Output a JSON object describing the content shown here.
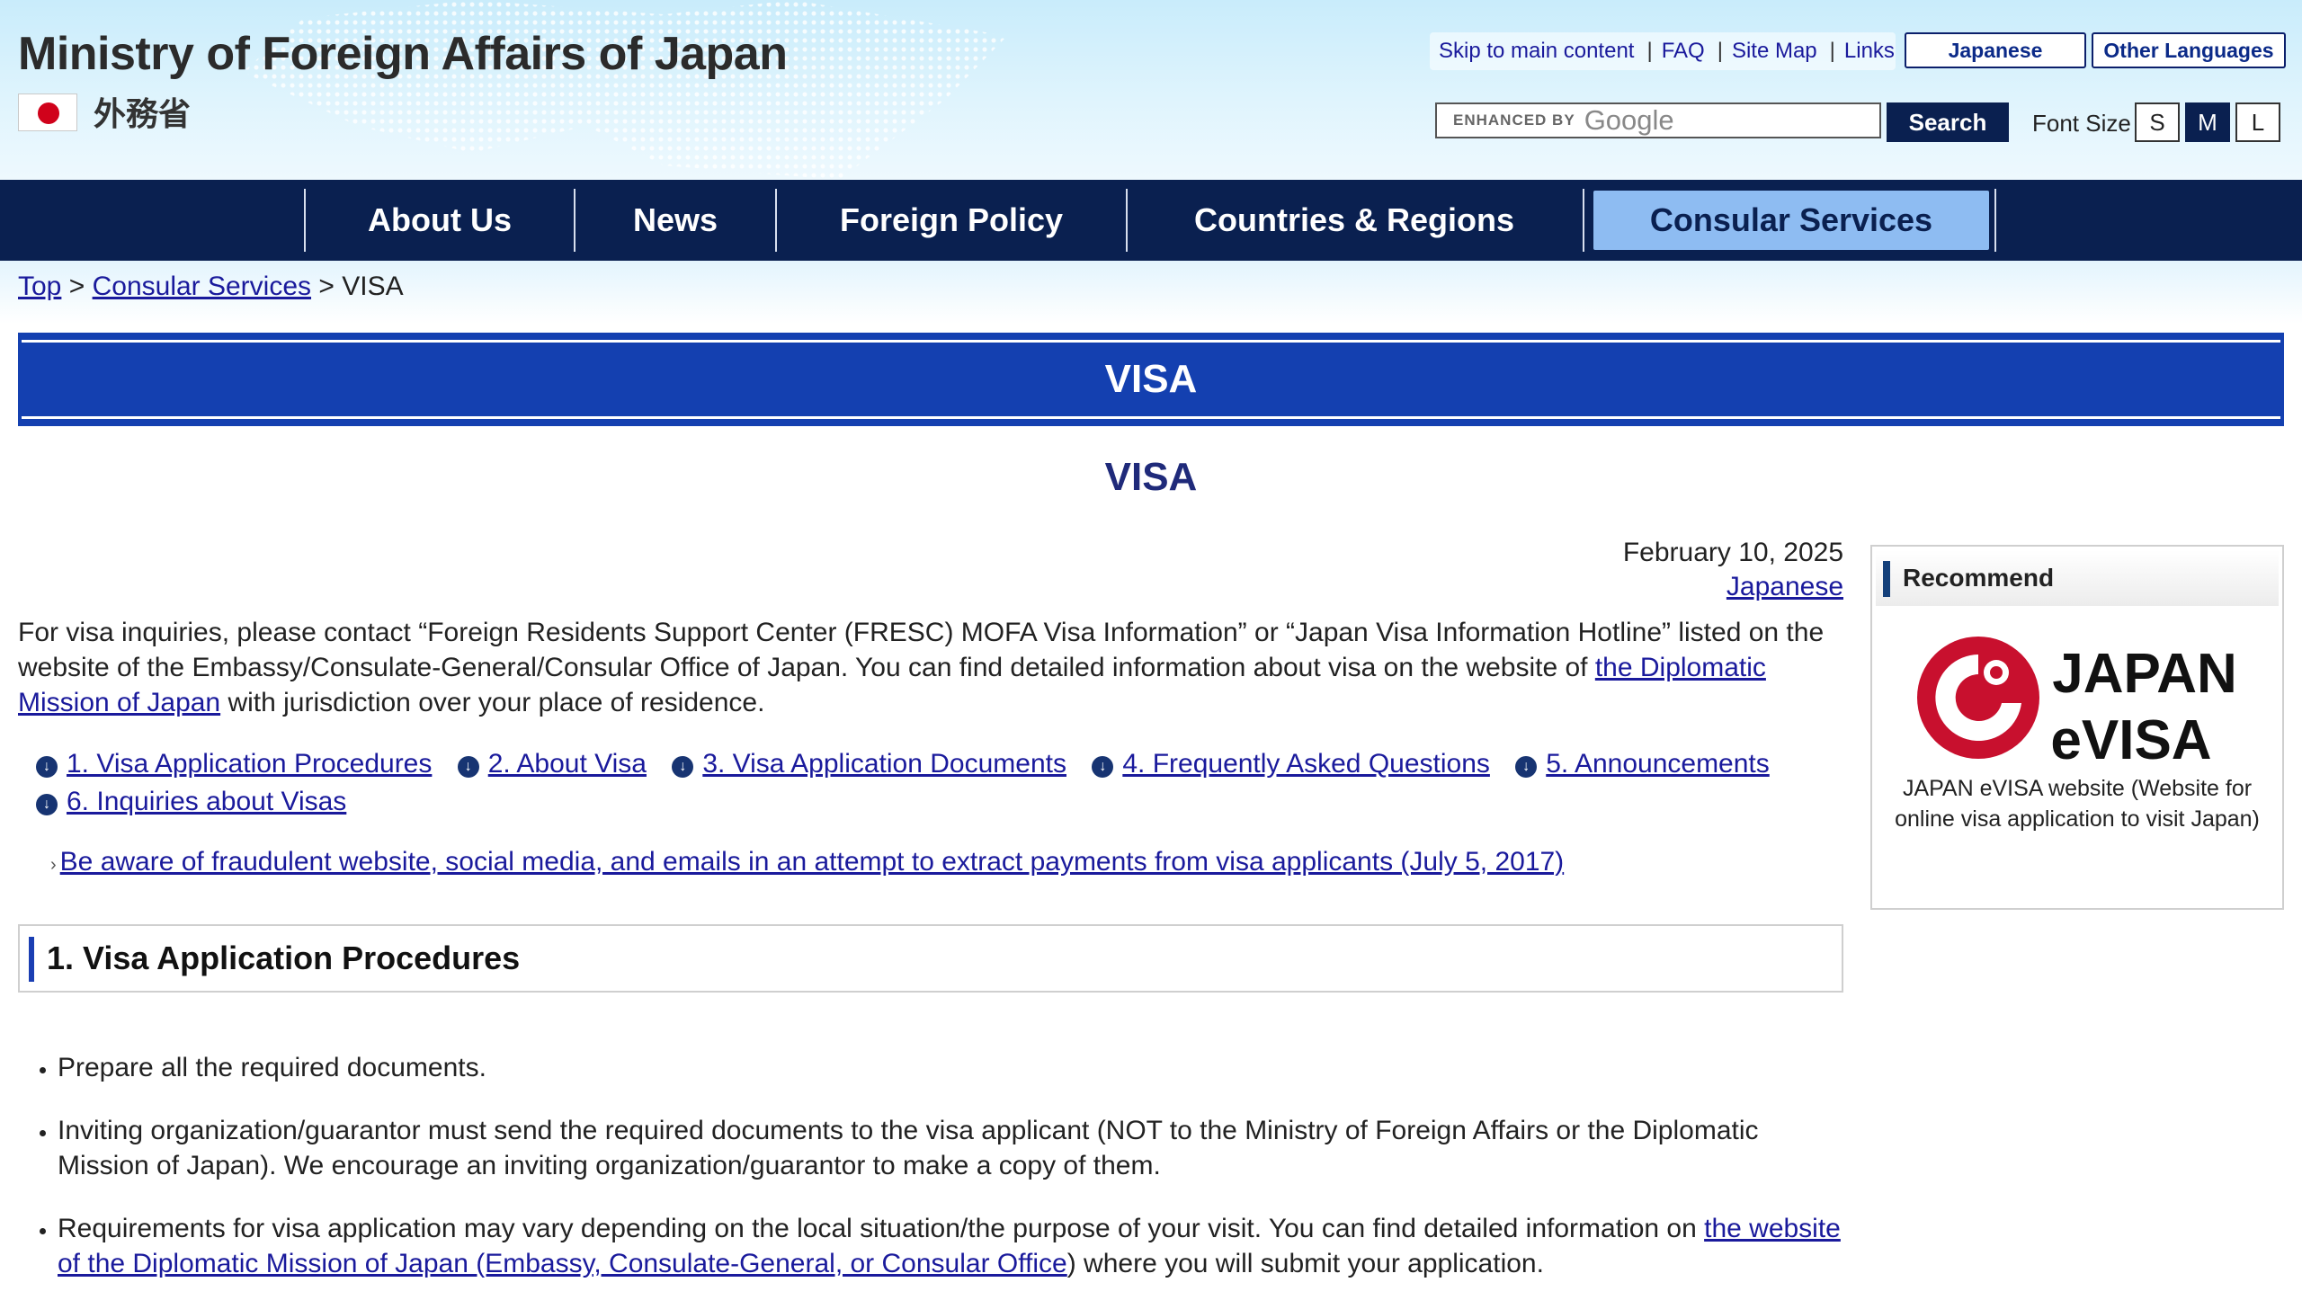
{
  "header": {
    "site_title": "Ministry of Foreign Affairs of Japan",
    "jp_name": "外務省",
    "util_links": [
      "Skip to main content",
      "FAQ",
      "Site Map",
      "Links"
    ],
    "lang_buttons": [
      "Japanese",
      "Other Languages"
    ],
    "search": {
      "enhanced_by": "ENHANCED BY",
      "google": "Google",
      "button": "Search"
    },
    "font_size": {
      "label": "Font Size",
      "options": [
        "S",
        "M",
        "L"
      ],
      "selected": "M"
    }
  },
  "nav": {
    "items": [
      "About Us",
      "News",
      "Foreign Policy",
      "Countries & Regions",
      "Consular Services"
    ],
    "active": "Consular Services"
  },
  "breadcrumb": {
    "top": "Top",
    "sep": ">",
    "consular": "Consular Services",
    "current": "VISA"
  },
  "page": {
    "title": "VISA",
    "subtitle": "VISA",
    "date": "February 10, 2025",
    "japanese_link": "Japanese",
    "intro_1": "For visa inquiries, please contact “Foreign Residents Support Center (FRESC) MOFA Visa Information” or “Japan Visa Information Hotline” listed on the website of the Embassy/Consulate-General/Consular Office of Japan. You can find detailed information about visa on the website of ",
    "intro_link": "the Diplomatic Mission of Japan",
    "intro_2": " with jurisdiction over your place of residence.",
    "toc": [
      "1. Visa Application Procedures",
      "2. About Visa",
      "3. Visa Application Documents",
      "4. Frequently Asked Questions",
      "5. Announcements",
      "6. Inquiries about Visas"
    ],
    "warning_link": "Be aware of fraudulent website, social media, and emails in an attempt to extract payments from visa applicants (July 5, 2017)",
    "section_1_title": "1. Visa Application Procedures",
    "bullets": {
      "b1": "Prepare all the required documents.",
      "b2": "Inviting organization/guarantor must send the required documents to the visa applicant (NOT to the Ministry of Foreign Affairs or the Diplomatic Mission of Japan). We encourage an inviting organization/guarantor to make a copy of them.",
      "b3_text": "Requirements for visa application may vary depending on the local situation/the purpose of your visit. You can find detailed information on ",
      "b3_link": "the website of the Diplomatic Mission of Japan (Embassy, Consulate-General, or Consular Office",
      "b3_tail": ") where you will submit your application."
    }
  },
  "sidebar": {
    "heading": "Recommend",
    "logo_text_1": "JAPAN",
    "logo_text_2": "eVISA",
    "caption": "JAPAN eVISA website (Website for online visa application to visit Japan)"
  },
  "colors": {
    "nav_bg": "#0a2050",
    "nav_active": "#8ebcf2",
    "title_bar": "#1440b0",
    "link": "#1a1a9c",
    "logo_red": "#c8102e"
  }
}
